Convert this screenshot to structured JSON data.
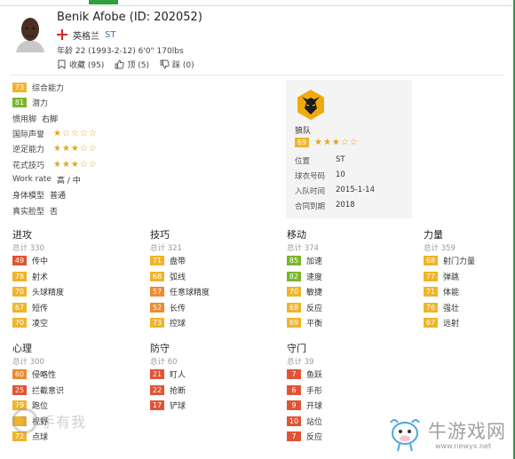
{
  "colors": {
    "green": "#7ab52c",
    "yellow": "#f0b429",
    "orange": "#ee8a2f",
    "red": "#e05434",
    "star": "#e8a317",
    "link": "#2f7dd1",
    "accent": "#2e9e3e"
  },
  "player": {
    "name": "Benik Afobe (ID: 202052)",
    "nation": "英格兰",
    "position": "ST",
    "bio": "年龄 22 (1993-2-12) 6'0\" 170lbs",
    "actions": [
      {
        "icon": "bookmark-icon",
        "label": "收藏 (95)"
      },
      {
        "icon": "thumbs-up-icon",
        "label": "顶 (5)"
      },
      {
        "icon": "thumbs-down-icon",
        "label": "踩 (0)"
      }
    ]
  },
  "info": [
    {
      "label": "综合能力",
      "badge": "73",
      "badge_color": "yellow"
    },
    {
      "label": "潜力",
      "badge": "81",
      "badge_color": "green"
    },
    {
      "label": "惯用脚",
      "value": "右脚"
    },
    {
      "label": "国际声誉",
      "stars": 1
    },
    {
      "label": "逆足能力",
      "stars": 3
    },
    {
      "label": "花式技巧",
      "stars": 3
    },
    {
      "label": "Work rate",
      "value": "高 / 中"
    },
    {
      "label": "身体模型",
      "value": "普通"
    },
    {
      "label": "真实脸型",
      "value": "否"
    }
  ],
  "club": {
    "logo_icon": "wolves-crest-icon",
    "name": "狼队",
    "rating": "69",
    "stars": 3,
    "rows": [
      {
        "label": "位置",
        "value": "ST",
        "link": true
      },
      {
        "label": "球衣号码",
        "value": "10"
      },
      {
        "label": "入队时间",
        "value": "2015-1-14"
      },
      {
        "label": "合同到期",
        "value": "2018"
      }
    ]
  },
  "categories": [
    {
      "key": "attack",
      "title": "进攻",
      "total": "总计 330",
      "stats": [
        {
          "v": "49",
          "n": "传中",
          "c": "red"
        },
        {
          "v": "78",
          "n": "射术",
          "c": "yellow"
        },
        {
          "v": "70",
          "n": "头球精度",
          "c": "yellow"
        },
        {
          "v": "67",
          "n": "短传",
          "c": "yellow"
        },
        {
          "v": "70",
          "n": "凌空",
          "c": "yellow"
        }
      ]
    },
    {
      "key": "skill",
      "title": "技巧",
      "total": "总计 321",
      "stats": [
        {
          "v": "71",
          "n": "盘带",
          "c": "yellow"
        },
        {
          "v": "68",
          "n": "弧线",
          "c": "yellow"
        },
        {
          "v": "57",
          "n": "任意球精度",
          "c": "orange"
        },
        {
          "v": "52",
          "n": "长传",
          "c": "orange"
        },
        {
          "v": "73",
          "n": "控球",
          "c": "yellow"
        }
      ]
    },
    {
      "key": "movement",
      "title": "移动",
      "total": "总计 374",
      "stats": [
        {
          "v": "85",
          "n": "加速",
          "c": "green"
        },
        {
          "v": "82",
          "n": "速度",
          "c": "green"
        },
        {
          "v": "70",
          "n": "敏捷",
          "c": "yellow"
        },
        {
          "v": "68",
          "n": "反应",
          "c": "yellow"
        },
        {
          "v": "69",
          "n": "平衡",
          "c": "yellow"
        }
      ]
    },
    {
      "key": "power",
      "title": "力量",
      "total": "总计 359",
      "stats": [
        {
          "v": "68",
          "n": "射门力量",
          "c": "yellow"
        },
        {
          "v": "77",
          "n": "弹跳",
          "c": "yellow"
        },
        {
          "v": "71",
          "n": "体能",
          "c": "yellow"
        },
        {
          "v": "76",
          "n": "强壮",
          "c": "yellow"
        },
        {
          "v": "67",
          "n": "远射",
          "c": "yellow"
        }
      ]
    },
    {
      "key": "mentality",
      "title": "心理",
      "total": "总计 300",
      "stats": [
        {
          "v": "60",
          "n": "侵略性",
          "c": "orange"
        },
        {
          "v": "25",
          "n": "拦截意识",
          "c": "red"
        },
        {
          "v": "79",
          "n": "跑位",
          "c": "yellow"
        },
        {
          "v": "",
          "n": "视野",
          "c": "yellow"
        },
        {
          "v": "72",
          "n": "点球",
          "c": "yellow"
        }
      ]
    },
    {
      "key": "defending",
      "title": "防守",
      "total": "总计 60",
      "stats": [
        {
          "v": "21",
          "n": "盯人",
          "c": "red"
        },
        {
          "v": "22",
          "n": "抢断",
          "c": "red"
        },
        {
          "v": "17",
          "n": "铲球",
          "c": "red"
        }
      ]
    },
    {
      "key": "goalkeeping",
      "title": "守门",
      "total": "总计 39",
      "stats": [
        {
          "v": "7",
          "n": "鱼跃",
          "c": "red"
        },
        {
          "v": "6",
          "n": "手形",
          "c": "red"
        },
        {
          "v": "9",
          "n": "开球",
          "c": "red"
        },
        {
          "v": "10",
          "n": "站位",
          "c": "red"
        },
        {
          "v": "7",
          "n": "反应",
          "c": "red"
        }
      ]
    }
  ],
  "watermarks": {
    "left_text": "手有我",
    "right_title": "牛游戏网",
    "right_url": "www.newyx.net"
  }
}
